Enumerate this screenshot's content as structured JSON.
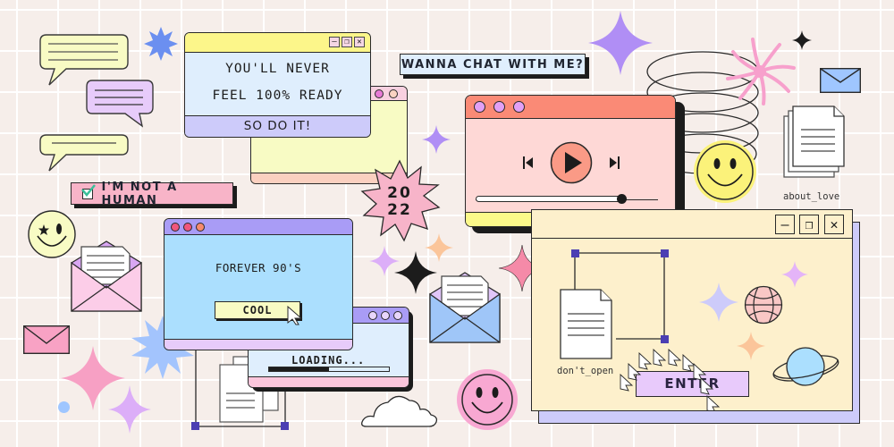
{
  "colors": {
    "background": "#f6eeea",
    "grid": "#ffffff",
    "outline": "#2a2a2a",
    "pink": "#f7a8c8",
    "lilac": "#d8b4f8",
    "periwinkle": "#c9c8fb",
    "sky": "#aee0ff",
    "yellow": "#fdfa8a",
    "salmon": "#fa8a76",
    "cream": "#fdf0cc"
  },
  "motivation_window": {
    "line1": "YOU'LL NEVER",
    "line2": "FEEL 100% READY",
    "footer": "SO DO IT!",
    "controls": {
      "minimize": "—",
      "maximize": "❐",
      "close": "✕"
    }
  },
  "chat_label": "WANNA CHAT WITH ME?",
  "captcha": {
    "label": "I'M NOT A HUMAN",
    "checked": true
  },
  "sticker_year": {
    "line1": "20",
    "line2": "22"
  },
  "media_player": {
    "icons": [
      "previous-icon",
      "play-icon",
      "next-icon"
    ],
    "progress": 0.8
  },
  "retro_window": {
    "title": "FOREVER 90'S",
    "button_label": "COOL"
  },
  "loading_window": {
    "label": "LOADING...",
    "progress": 0.5
  },
  "desktop_files": [
    {
      "name": "about_love"
    },
    {
      "name": "don't_open"
    }
  ],
  "enter_window": {
    "button_label": "ENTER",
    "controls": {
      "minimize": "—",
      "maximize": "❐",
      "close": "✕"
    }
  }
}
